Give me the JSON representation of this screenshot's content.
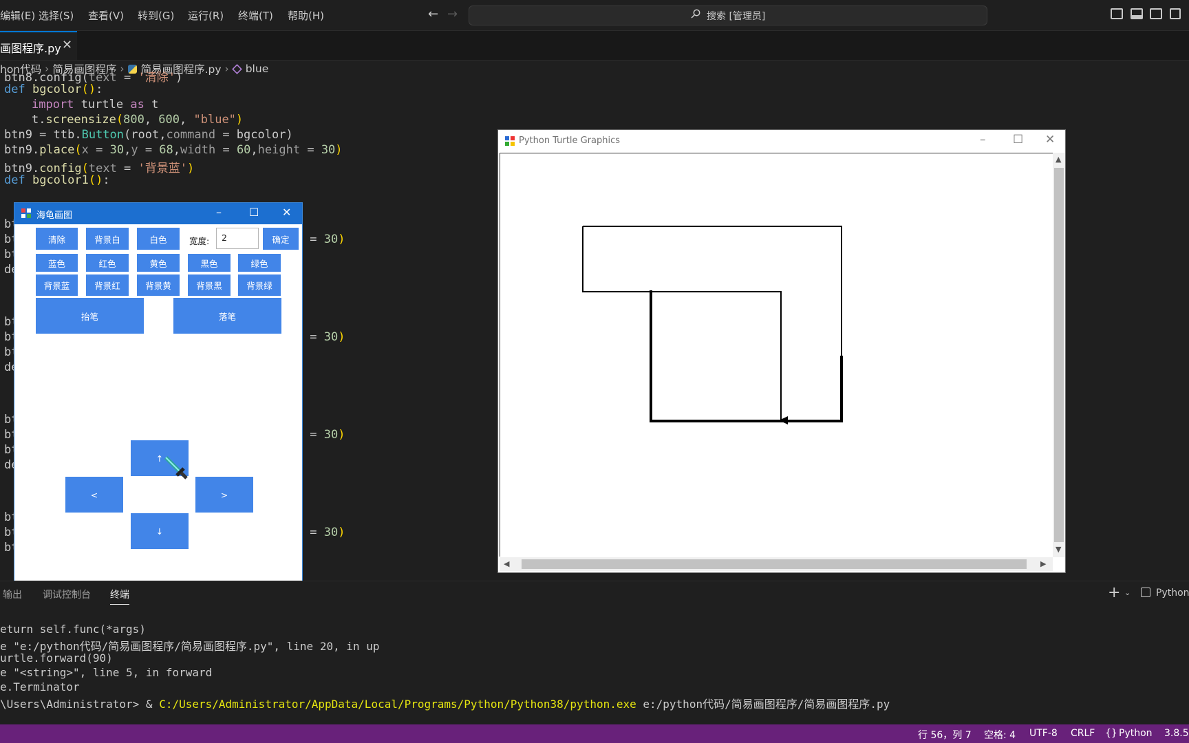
{
  "menu": {
    "items": [
      "编辑(E)",
      "选择(S)",
      "查看(V)",
      "转到(G)",
      "运行(R)",
      "终端(T)",
      "帮助(H)"
    ],
    "search": "搜索 [管理员]"
  },
  "tab": {
    "label": "画图程序.py",
    "close": "✕"
  },
  "breadcrumb": {
    "folder": "hon代码",
    "subfolder": "简易画图程序",
    "file": "简易画图程序.py",
    "symbol": "blue"
  },
  "code": {
    "l0_a": "btn8.config(",
    "l0_b": "text",
    " l0_c": " = ",
    "l0_d": "'清除'",
    "l0_e": ")",
    "def_kw": "def",
    "bgcolor": "bgcolor",
    "parens": "()",
    "colon": ":",
    "import_kw": "import",
    "turtle": "turtle",
    "as_kw": "as",
    "t": "t",
    "screensize_a": "t.",
    "screensize_fn": "screensize",
    "screensize_open": "(",
    "w800": "800",
    "comma1": ", ",
    "h600": "600",
    "comma2": ", ",
    "blue_str": "\"blue\"",
    "screensize_close": ")",
    "btn9_a": "btn9 = ttb.",
    "btn9_cls": "Button",
    "btn9_b": "(root,",
    "btn9_cmd": "command",
    "btn9_c": " = bgcolor)",
    "place_a": "btn9.",
    "place_fn": "place",
    "place_open": "(",
    "px": "x",
    "peq1": " = ",
    "p30": "30",
    "pc1": ",",
    "py": "y",
    "peq2": " = ",
    "p68": "68",
    "pc2": ",",
    "pw": "width",
    "peq3": " = ",
    "p60": "60",
    "pc3": ",",
    "ph": "height",
    "peq4": " = ",
    "p30b": "30",
    "place_close": ")",
    "config_a": "btn9.",
    "config_fn": "config",
    "config_open": "(",
    "ctext": "text",
    "ceq": " = ",
    "cstr": "'背景蓝'",
    "config_close": ")",
    "bgcolor1": "bgcolor1",
    "frag_bt": "bt",
    "frag_btn": "btn",
    "frag_de": "de",
    "frag_eq30": "= 30)"
  },
  "tk": {
    "title": "海龟画图",
    "row1": [
      "清除",
      "背景白",
      "白色"
    ],
    "width_label": "宽度:",
    "width_value": "2",
    "confirm": "确定",
    "row2": [
      "蓝色",
      "红色",
      "黄色",
      "黑色",
      "绿色"
    ],
    "row3": [
      "背景蓝",
      "背景红",
      "背景黄",
      "背景黑",
      "背景绿"
    ],
    "pen_up": "抬笔",
    "pen_down": "落笔",
    "up": "↑",
    "left": "<",
    "right": ">",
    "down": "↓"
  },
  "turtle_window": {
    "title": "Python Turtle Graphics"
  },
  "panel": {
    "tabs": [
      "输出",
      "调试控制台",
      "终端"
    ],
    "add": "+",
    "profile": "Python"
  },
  "terminal": {
    "l1": "eturn self.func(*args)",
    "l2": "e \"e:/python代码/简易画图程序/简易画图程序.py\", line 20, in up",
    "l3": "urtle.forward(90)",
    "l4": "e \"<string>\", line 5, in forward",
    "l5": "e.Terminator",
    "l6_prompt": "\\Users\\Administrator> & ",
    "l6_exe": "C:/Users/Administrator/AppData/Local/Programs/Python/Python38/python.exe",
    "l6_arg": " e:/python代码/简易画图程序/简易画图程序.py"
  },
  "status": {
    "position": "行 56，列 7",
    "spaces": "空格: 4",
    "encoding": "UTF-8",
    "eol": "CRLF",
    "language": "Python",
    "version": "3.8.5"
  },
  "colors": {
    "accent": "#0078d4",
    "status_bg": "#68217a",
    "tk_button": "#4285e8",
    "tk_title": "#1c6fd0"
  }
}
